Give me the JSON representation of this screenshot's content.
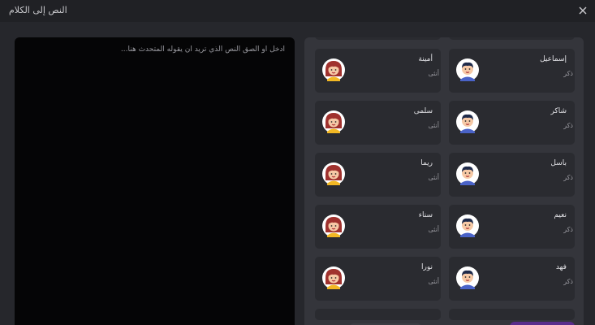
{
  "window": {
    "title": "النص إلى الكلام",
    "close_icon": "close-icon"
  },
  "editor": {
    "placeholder": "أدخل أو الصق النص الذي تريد أن يقوله المتحدث هنا..."
  },
  "voices": {
    "male_label": "ذكر",
    "female_label": "أنثى",
    "items": [
      {
        "name": "إسماعيل",
        "gender": "ذكر",
        "avatar": "male-avatar-icon"
      },
      {
        "name": "أمينة",
        "gender": "أنثى",
        "avatar": "female-avatar-icon"
      },
      {
        "name": "شاكر",
        "gender": "ذكر",
        "avatar": "male-avatar-icon"
      },
      {
        "name": "سلمى",
        "gender": "أنثى",
        "avatar": "female-avatar-icon"
      },
      {
        "name": "باسل",
        "gender": "ذكر",
        "avatar": "male-avatar-icon"
      },
      {
        "name": "ريما",
        "gender": "أنثى",
        "avatar": "female-avatar-icon"
      },
      {
        "name": "نعيم",
        "gender": "ذكر",
        "avatar": "male-avatar-icon"
      },
      {
        "name": "سناء",
        "gender": "أنثى",
        "avatar": "female-avatar-icon"
      },
      {
        "name": "فهد",
        "gender": "ذكر",
        "avatar": "male-avatar-icon"
      },
      {
        "name": "نورا",
        "gender": "أنثى",
        "avatar": "female-avatar-icon"
      }
    ]
  },
  "colors": {
    "accent": "#5a2d8c",
    "background": "#26272c",
    "card": "#2a2b30"
  }
}
